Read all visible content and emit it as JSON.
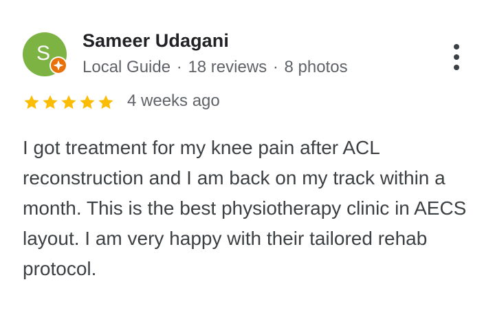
{
  "review": {
    "reviewer": {
      "initial": "S",
      "name": "Sameer Udagani",
      "badge_icon": "local-guide-badge-icon",
      "guide_label": "Local Guide",
      "reviews": "18 reviews",
      "photos": "8 photos",
      "separator": "·"
    },
    "rating": 5,
    "rating_max": 5,
    "date": "4 weeks ago",
    "text": "I got treatment for my knee pain after ACL reconstruction and I am back on my track within a month. This is the best physiotherapy clinic in AECS layout. I am very happy with their tailored rehab protocol.",
    "more_icon": "more-vertical-icon"
  },
  "colors": {
    "avatar_bg": "#7cb342",
    "badge_bg": "#e8710a",
    "star": "#fbbc04",
    "name_text": "#202124",
    "meta_text": "#5f6368",
    "body_text": "#3c4043"
  }
}
